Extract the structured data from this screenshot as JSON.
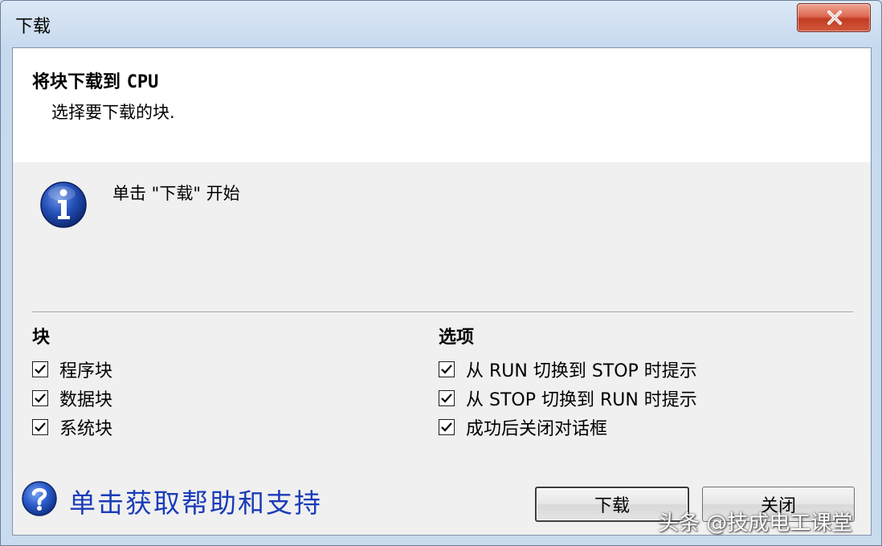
{
  "window": {
    "title": "下载"
  },
  "header": {
    "title_prefix": "将块下载到",
    "title_cpu": "CPU",
    "subtitle": "选择要下载的块."
  },
  "message": {
    "text": "单击 \"下载\" 开始",
    "icon": "info-icon"
  },
  "blocks": {
    "title": "块",
    "items": [
      {
        "label": "程序块",
        "checked": true
      },
      {
        "label": "数据块",
        "checked": true
      },
      {
        "label": "系统块",
        "checked": true
      }
    ]
  },
  "options": {
    "title": "选项",
    "items": [
      {
        "label": "从 RUN 切换到 STOP 时提示",
        "checked": true
      },
      {
        "label": "从 STOP 切换到 RUN 时提示",
        "checked": true
      },
      {
        "label": "成功后关闭对话框",
        "checked": true
      }
    ]
  },
  "help": {
    "link_text": "单击获取帮助和支持",
    "icon": "help-icon"
  },
  "buttons": {
    "download": "下载",
    "close": "关闭"
  },
  "watermark": "头条 @技成电工课堂",
  "colors": {
    "link": "#1a3cb8",
    "close_button": "#c94a32",
    "frame": "#c9dbef"
  }
}
